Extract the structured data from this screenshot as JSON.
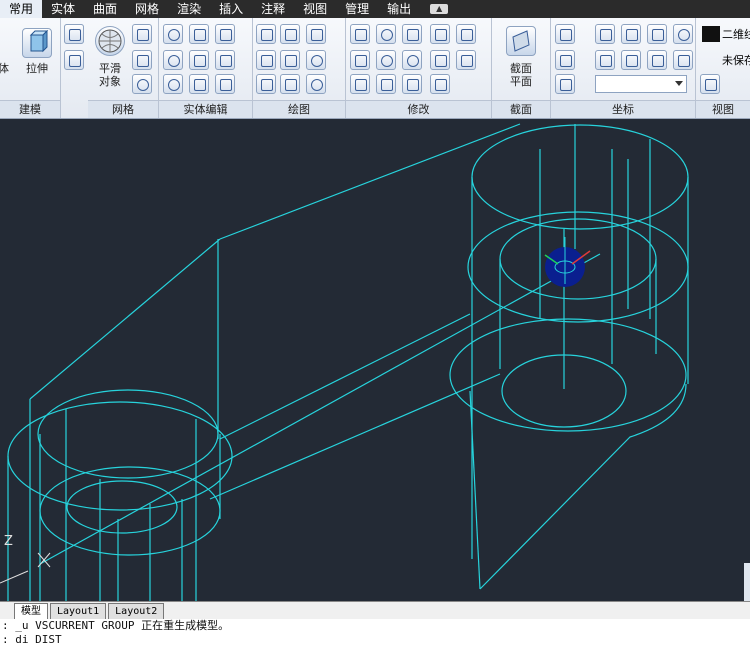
{
  "menu": {
    "tabs": [
      "常用",
      "实体",
      "曲面",
      "网格",
      "渲染",
      "插入",
      "注释",
      "视图",
      "管理",
      "输出"
    ],
    "active": "常用",
    "extra_icon": "window-toggle-icon"
  },
  "ribbon": {
    "panels": {
      "modeling": {
        "title": "建模",
        "extrude_label": "拉伸",
        "left_label": "体"
      },
      "mesh": {
        "title": "网格",
        "smooth_label_1": "平滑",
        "smooth_label_2": "对象"
      },
      "solid_edit": {
        "title": "实体编辑"
      },
      "draw": {
        "title": "绘图"
      },
      "modify": {
        "title": "修改"
      },
      "section": {
        "title": "截面",
        "plane_label_1": "截面",
        "plane_label_2": "平面"
      },
      "coordinates": {
        "title": "坐标"
      },
      "view": {
        "title": "视图",
        "visual_style": "二维线",
        "unsaved_view": "未保存"
      }
    }
  },
  "layout_tabs": [
    "模型",
    "Layout1",
    "Layout2"
  ],
  "active_layout": "模型",
  "command_lines": [
    ": _u VSCURRENT GROUP 正在重生成模型。",
    ": di DIST"
  ],
  "ucs": {
    "z_label": "Z"
  },
  "colors": {
    "wire": "#27d3dc",
    "background": "#232a35"
  }
}
